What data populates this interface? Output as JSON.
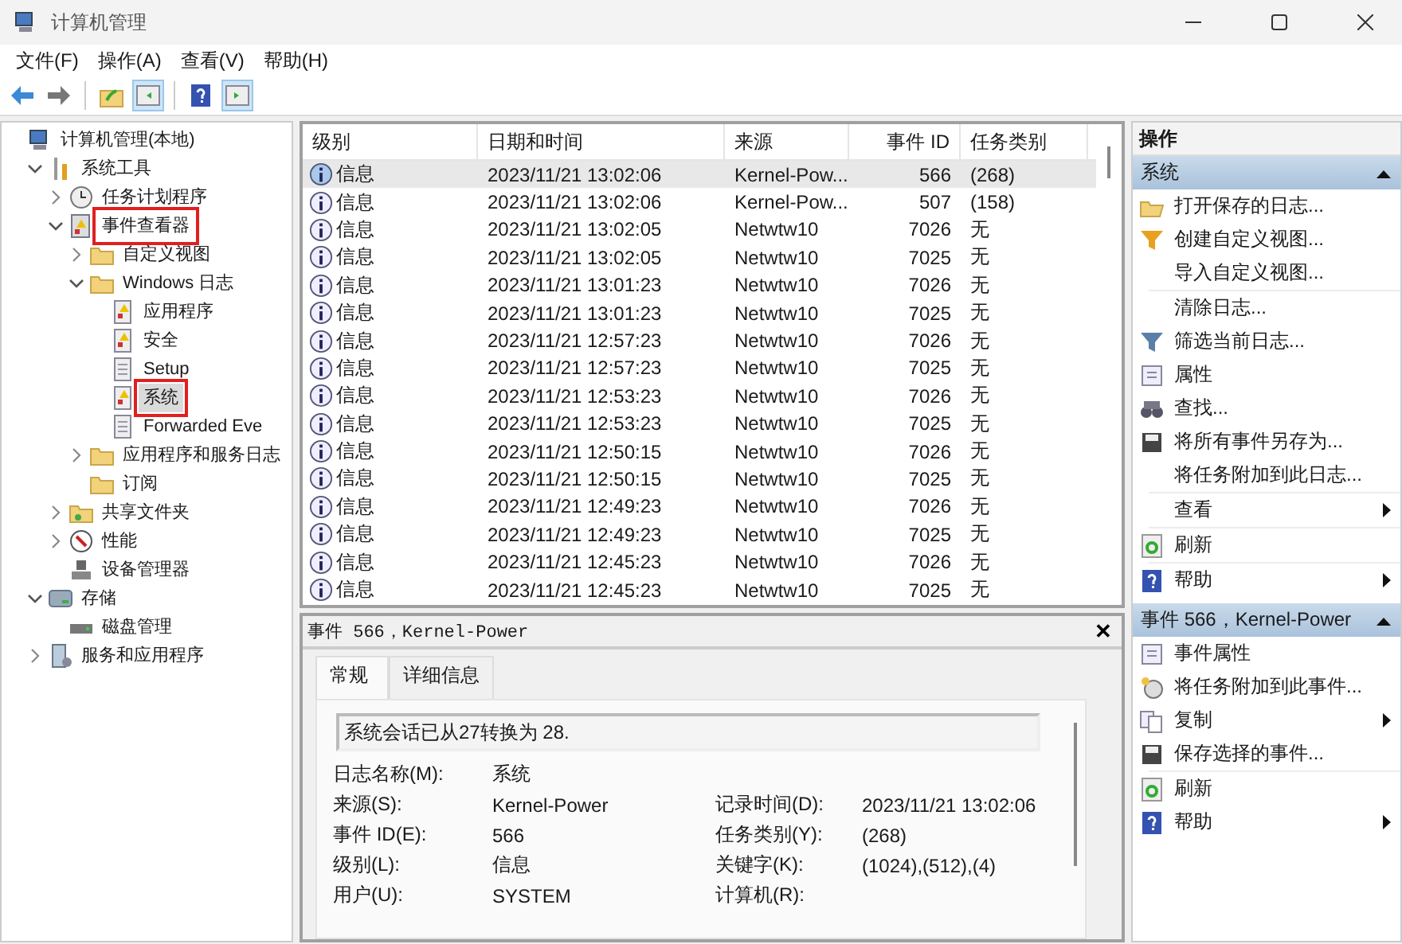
{
  "window": {
    "title": "计算机管理"
  },
  "menu": [
    "文件(F)",
    "操作(A)",
    "查看(V)",
    "帮助(H)"
  ],
  "toolbar": [
    {
      "kind": "back",
      "pressed": false
    },
    {
      "kind": "forward",
      "pressed": false
    },
    {
      "kind": "sep"
    },
    {
      "kind": "up",
      "pressed": false
    },
    {
      "kind": "tree-toggle",
      "pressed": true
    },
    {
      "kind": "sep"
    },
    {
      "kind": "help",
      "pressed": false
    },
    {
      "kind": "pane-toggle",
      "pressed": true
    }
  ],
  "tree": [
    {
      "label": "计算机管理(本地)",
      "kind": "computer",
      "selected": false,
      "annotated": false,
      "children": [
        {
          "label": "系统工具",
          "kind": "tools",
          "expanded": true,
          "selected": false,
          "annotated": false,
          "children": [
            {
              "label": "任务计划程序",
              "kind": "clock",
              "expanded": false,
              "selected": false,
              "annotated": false
            },
            {
              "label": "事件查看器",
              "kind": "viewer",
              "expanded": true,
              "selected": false,
              "annotated": true,
              "children": [
                {
                  "label": "自定义视图",
                  "kind": "folder",
                  "expanded": false,
                  "selected": false,
                  "annotated": false
                },
                {
                  "label": "Windows 日志",
                  "kind": "folder",
                  "expanded": true,
                  "selected": false,
                  "annotated": false,
                  "children": [
                    {
                      "label": "应用程序",
                      "kind": "log",
                      "selected": false,
                      "annotated": false
                    },
                    {
                      "label": "安全",
                      "kind": "log",
                      "selected": false,
                      "annotated": false
                    },
                    {
                      "label": "Setup",
                      "kind": "plainlog",
                      "selected": false,
                      "annotated": false
                    },
                    {
                      "label": "系统",
                      "kind": "log",
                      "selected": true,
                      "annotated": true
                    },
                    {
                      "label": "Forwarded Eve",
                      "kind": "plainlog",
                      "selected": false,
                      "annotated": false
                    }
                  ]
                },
                {
                  "label": "应用程序和服务日志",
                  "kind": "folder",
                  "expanded": false,
                  "selected": false,
                  "annotated": false
                },
                {
                  "label": "订阅",
                  "kind": "folder",
                  "selected": false,
                  "annotated": false
                }
              ]
            },
            {
              "label": "共享文件夹",
              "kind": "share",
              "expanded": false,
              "selected": false,
              "annotated": false
            },
            {
              "label": "性能",
              "kind": "perf",
              "expanded": false,
              "selected": false,
              "annotated": false
            },
            {
              "label": "设备管理器",
              "kind": "device",
              "selected": false,
              "annotated": false
            }
          ]
        },
        {
          "label": "存储",
          "kind": "storage",
          "expanded": true,
          "selected": false,
          "annotated": false,
          "children": [
            {
              "label": "磁盘管理",
              "kind": "disk",
              "selected": false,
              "annotated": false
            }
          ]
        },
        {
          "label": "服务和应用程序",
          "kind": "services",
          "expanded": false,
          "selected": false,
          "annotated": false
        }
      ]
    }
  ],
  "table": {
    "columns": [
      "级别",
      "日期和时间",
      "来源",
      "事件 ID",
      "任务类别"
    ],
    "rows": [
      {
        "level": "信息",
        "time": "2023/11/21 13:02:06",
        "source": "Kernel-Pow...",
        "id": "566",
        "task": "(268)",
        "selected": true
      },
      {
        "level": "信息",
        "time": "2023/11/21 13:02:06",
        "source": "Kernel-Pow...",
        "id": "507",
        "task": "(158)",
        "selected": false
      },
      {
        "level": "信息",
        "time": "2023/11/21 13:02:05",
        "source": "Netwtw10",
        "id": "7026",
        "task": "无",
        "selected": false
      },
      {
        "level": "信息",
        "time": "2023/11/21 13:02:05",
        "source": "Netwtw10",
        "id": "7025",
        "task": "无",
        "selected": false
      },
      {
        "level": "信息",
        "time": "2023/11/21 13:01:23",
        "source": "Netwtw10",
        "id": "7026",
        "task": "无",
        "selected": false
      },
      {
        "level": "信息",
        "time": "2023/11/21 13:01:23",
        "source": "Netwtw10",
        "id": "7025",
        "task": "无",
        "selected": false
      },
      {
        "level": "信息",
        "time": "2023/11/21 12:57:23",
        "source": "Netwtw10",
        "id": "7026",
        "task": "无",
        "selected": false
      },
      {
        "level": "信息",
        "time": "2023/11/21 12:57:23",
        "source": "Netwtw10",
        "id": "7025",
        "task": "无",
        "selected": false
      },
      {
        "level": "信息",
        "time": "2023/11/21 12:53:23",
        "source": "Netwtw10",
        "id": "7026",
        "task": "无",
        "selected": false
      },
      {
        "level": "信息",
        "time": "2023/11/21 12:53:23",
        "source": "Netwtw10",
        "id": "7025",
        "task": "无",
        "selected": false
      },
      {
        "level": "信息",
        "time": "2023/11/21 12:50:15",
        "source": "Netwtw10",
        "id": "7026",
        "task": "无",
        "selected": false
      },
      {
        "level": "信息",
        "time": "2023/11/21 12:50:15",
        "source": "Netwtw10",
        "id": "7025",
        "task": "无",
        "selected": false
      },
      {
        "level": "信息",
        "time": "2023/11/21 12:49:23",
        "source": "Netwtw10",
        "id": "7026",
        "task": "无",
        "selected": false
      },
      {
        "level": "信息",
        "time": "2023/11/21 12:49:23",
        "source": "Netwtw10",
        "id": "7025",
        "task": "无",
        "selected": false
      },
      {
        "level": "信息",
        "time": "2023/11/21 12:45:23",
        "source": "Netwtw10",
        "id": "7026",
        "task": "无",
        "selected": false
      },
      {
        "level": "信息",
        "time": "2023/11/21 12:45:23",
        "source": "Netwtw10",
        "id": "7025",
        "task": "无",
        "selected": false
      }
    ]
  },
  "detail": {
    "title": "事件 566，Kernel-Power",
    "close": "✕",
    "tabs": [
      {
        "label": "常规",
        "selected": true
      },
      {
        "label": "详细信息",
        "selected": false
      }
    ],
    "message": "系统会话已从27转换为 28.",
    "fields": [
      [
        {
          "label": "日志名称(M):",
          "value": "系统"
        }
      ],
      [
        {
          "label": "来源(S):",
          "value": "Kernel-Power"
        },
        {
          "label": "记录时间(D):",
          "value": "2023/11/21 13:02:06"
        }
      ],
      [
        {
          "label": "事件 ID(E):",
          "value": "566"
        },
        {
          "label": "任务类别(Y):",
          "value": "(268)"
        }
      ],
      [
        {
          "label": "级别(L):",
          "value": "信息"
        },
        {
          "label": "关键字(K):",
          "value": "(1024),(512),(4)"
        }
      ],
      [
        {
          "label": "用户(U):",
          "value": "SYSTEM"
        },
        {
          "label": "计算机(R):"
        }
      ]
    ]
  },
  "actions": {
    "title": "操作",
    "sections": [
      {
        "title": "系统",
        "groups": [
          [
            {
              "label": "打开保存的日志...",
              "kind": "open",
              "submenu": false
            },
            {
              "label": "创建自定义视图...",
              "kind": "filter-new",
              "submenu": false
            },
            {
              "label": "导入自定义视图...",
              "kind": "none",
              "submenu": false
            }
          ],
          [
            {
              "label": "清除日志...",
              "kind": "none",
              "submenu": false
            },
            {
              "label": "筛选当前日志...",
              "kind": "filter",
              "submenu": false
            },
            {
              "label": "属性",
              "kind": "props",
              "submenu": false
            },
            {
              "label": "查找...",
              "kind": "find",
              "submenu": false
            },
            {
              "label": "将所有事件另存为...",
              "kind": "save",
              "submenu": false
            },
            {
              "label": "将任务附加到此日志...",
              "kind": "none",
              "submenu": false
            }
          ],
          [
            {
              "label": "查看",
              "kind": "none",
              "submenu": true
            }
          ],
          [
            {
              "label": "刷新",
              "kind": "refresh",
              "submenu": false
            }
          ],
          [
            {
              "label": "帮助",
              "kind": "help",
              "submenu": true
            }
          ]
        ]
      },
      {
        "title": "事件 566，Kernel-Power",
        "groups": [
          [
            {
              "label": "事件属性",
              "kind": "props",
              "submenu": false
            },
            {
              "label": "将任务附加到此事件...",
              "kind": "task",
              "submenu": false
            },
            {
              "label": "复制",
              "kind": "copy",
              "submenu": true
            },
            {
              "label": "保存选择的事件...",
              "kind": "save",
              "submenu": false
            }
          ],
          [
            {
              "label": "刷新",
              "kind": "refresh",
              "submenu": false
            },
            {
              "label": "帮助",
              "kind": "help",
              "submenu": true
            }
          ]
        ]
      }
    ]
  }
}
